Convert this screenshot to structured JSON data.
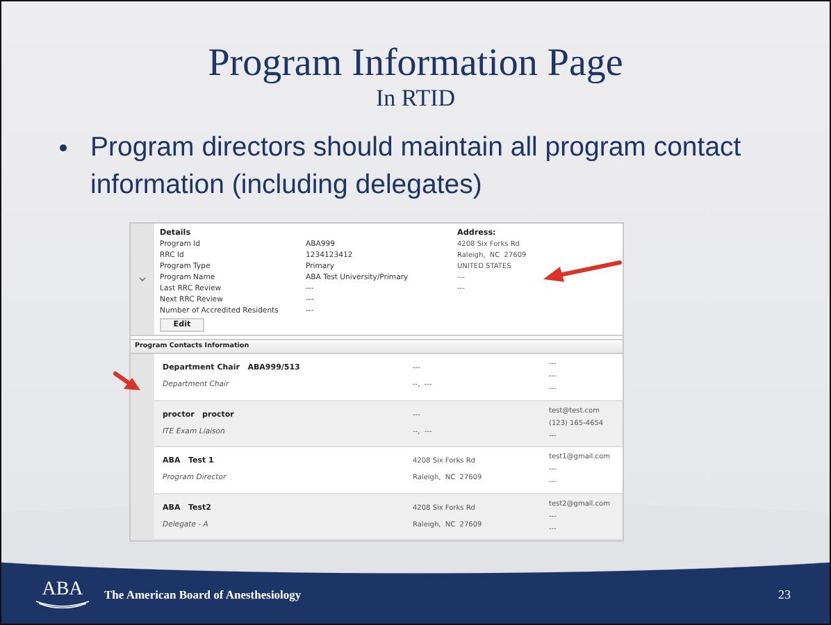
{
  "slide": {
    "title": "Program Information Page",
    "subtitle": "In RTID",
    "bullets": [
      "Program directors should maintain all program contact information (including delegates)"
    ]
  },
  "screenshot": {
    "details_heading": "Details",
    "details": [
      {
        "label": "Program Id",
        "value": "ABA999"
      },
      {
        "label": "RRC Id",
        "value": "1234123412"
      },
      {
        "label": "Program Type",
        "value": "Primary"
      },
      {
        "label": "Program Name",
        "value": "ABA Test University/Primary"
      },
      {
        "label": "Last RRC Review",
        "value": "---"
      },
      {
        "label": "Next RRC Review",
        "value": "---"
      },
      {
        "label": "Number of Accredited Residents",
        "value": "---"
      }
    ],
    "address_heading": "Address:",
    "address_lines": [
      "4208 Six Forks Rd",
      "Raleigh,  NC  27609",
      "UNITED STATES",
      "---",
      "---"
    ],
    "edit_button": "Edit",
    "contacts_heading": "Program Contacts Information",
    "contacts": [
      {
        "name": "Department Chair   ABA999/513",
        "role": "Department Chair",
        "address_lines": [
          "---",
          "--,  ---"
        ],
        "contact_lines": [
          "---",
          "---",
          "---"
        ]
      },
      {
        "name": "proctor   proctor",
        "role": "ITE Exam Liaison",
        "address_lines": [
          "---",
          "--,  ---"
        ],
        "contact_lines": [
          "test@test.com",
          "(123) 165-4654",
          "---"
        ]
      },
      {
        "name": "ABA   Test 1",
        "role": "Program Director",
        "address_lines": [
          "4208 Six Forks Rd",
          "Raleigh,  NC  27609"
        ],
        "contact_lines": [
          "test1@gmail.com",
          "---",
          "---"
        ]
      },
      {
        "name": "ABA   Test2",
        "role": "Delegate - A",
        "address_lines": [
          "4208 Six Forks Rd",
          "Raleigh,  NC  27609"
        ],
        "contact_lines": [
          "test2@gmail.com",
          "---",
          "---"
        ]
      }
    ]
  },
  "footer": {
    "logo_text": "ABA",
    "organization": "The American Board of Anesthesiology",
    "page_number": "23"
  }
}
